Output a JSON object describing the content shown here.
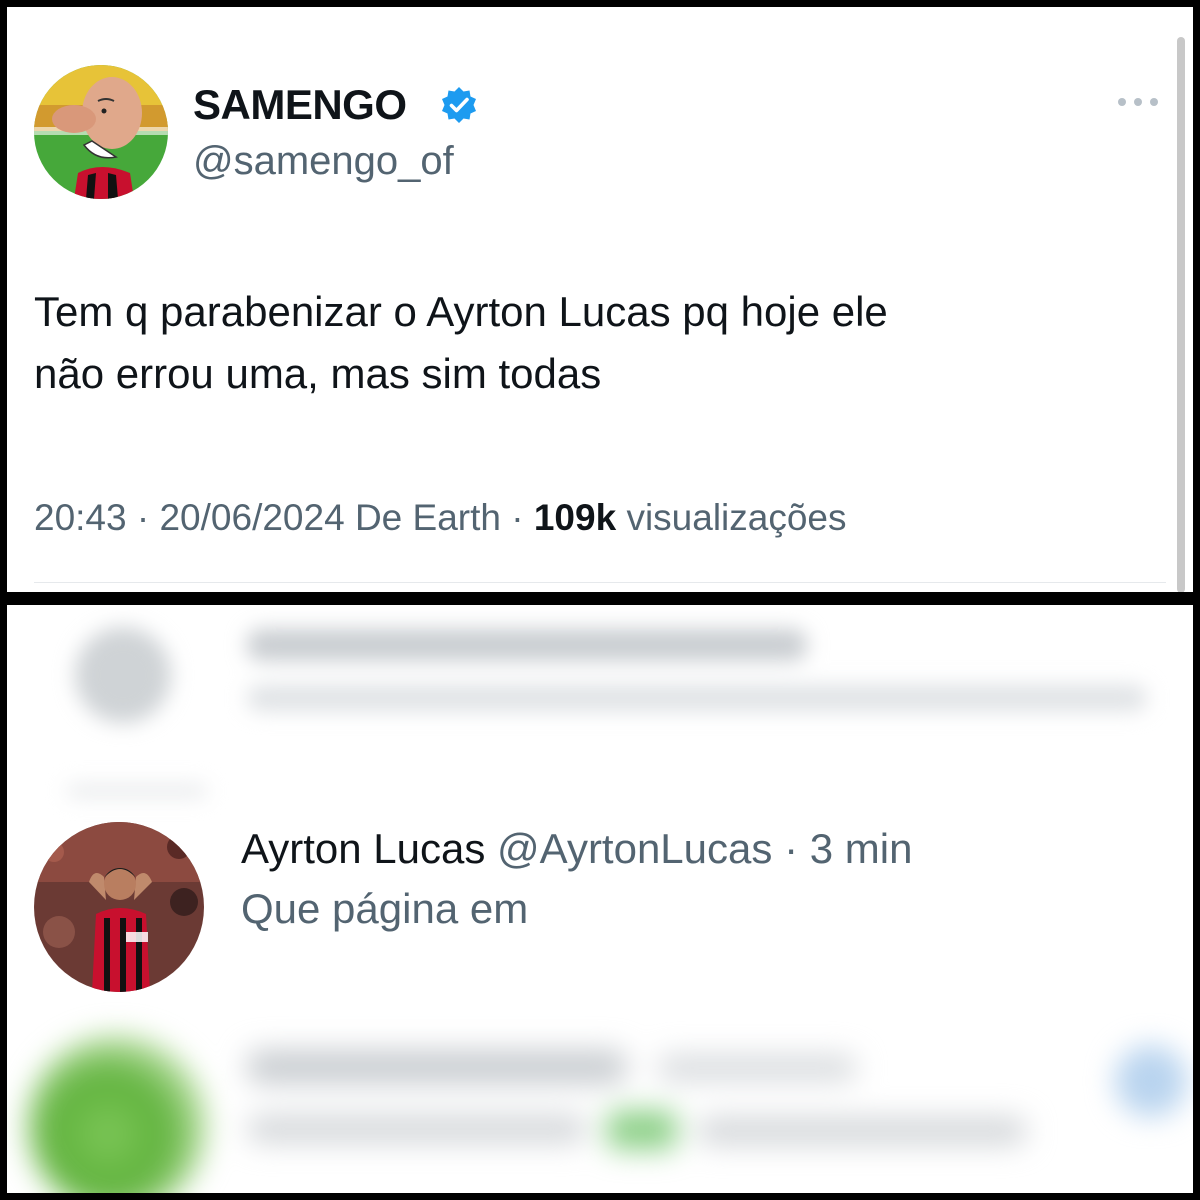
{
  "tweet": {
    "author_name": "SAMENGO",
    "author_handle": "@samengo_of",
    "verified_icon": "verified-badge-icon",
    "more_icon": "more-options-icon",
    "text_line1": "Tem q parabenizar o Ayrton Lucas pq hoje ele",
    "text_line2": "não errou uma, mas sim todas",
    "time": "20:43",
    "separator": "·",
    "date": "20/06/2024",
    "source": "De Earth",
    "views_count": "109k",
    "views_label": "visualizações"
  },
  "reply": {
    "author_name": "Ayrton Lucas",
    "author_handle": "@AyrtonLucas",
    "separator": "·",
    "time": "3 min",
    "text": "Que página em"
  },
  "colors": {
    "text_primary": "#0f1419",
    "text_secondary": "#536471",
    "verified_blue": "#1d9bf0",
    "frame": "#000000"
  }
}
